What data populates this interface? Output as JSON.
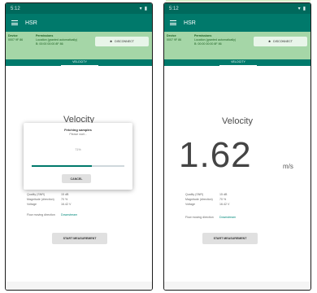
{
  "status_bar": {
    "time": "5:12",
    "icons": [
      "wifi-icon",
      "battery-icon"
    ]
  },
  "app": {
    "title": "HSR"
  },
  "info_panel": {
    "col1": {
      "header": "Device",
      "line": "0007 9F 86"
    },
    "col2": {
      "header": "Permissions",
      "lines": [
        "Location (granted automatically)",
        "B: 00:00 00:00 8F 86"
      ]
    },
    "disconnect_label": "DISCONNECT"
  },
  "tab_label": "VELOCITY",
  "velocity": {
    "title": "Velocity",
    "value": "1.62",
    "unit": "m/s"
  },
  "dialog": {
    "title": "Fetching samples",
    "subtitle": "Please wait...",
    "percent_text": "71%",
    "progress": 0.65,
    "cancel_label": "CANCEL"
  },
  "readings": [
    {
      "label": "Quality (SNR)",
      "value": "15 dB"
    },
    {
      "label": "Magnitude (direction)",
      "value": "70 %"
    },
    {
      "label": "Voltage",
      "value": "16.42 V"
    }
  ],
  "direction": {
    "label": "Flow moving direction",
    "value": "Downstream"
  },
  "start_label": "START MEASUREMENT",
  "colors": {
    "primary": "#00796b",
    "status": "#00695c",
    "panel": "#a5d6a7",
    "accent": "#00897b"
  }
}
